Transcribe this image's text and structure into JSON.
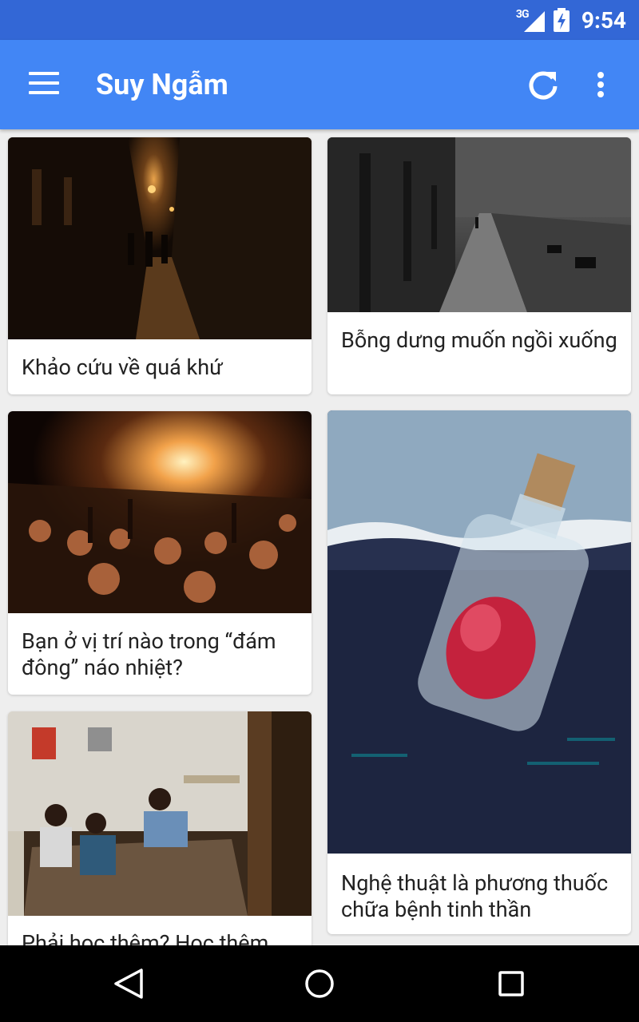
{
  "status_bar": {
    "network": "3G",
    "time": "9:54",
    "icons": [
      "signal-icon",
      "battery-charging-icon"
    ]
  },
  "app_bar": {
    "title": "Suy Ngẫm",
    "icons": [
      "menu-icon",
      "refresh-icon",
      "more-vert-icon"
    ]
  },
  "articles": [
    {
      "title": "Khảo cứu về quá khứ",
      "image": "night street photo"
    },
    {
      "title": "Bỗng dưng muốn ngồi xuống",
      "image": "rainy park path photo"
    },
    {
      "title": "Bạn ở vị trí nào trong “đám đông” náo nhiệt?",
      "image": "concert crowd photo"
    },
    {
      "title": "Nghệ thuật là phương thuốc chữa bệnh tinh thần",
      "image": "heart in bottle illustration"
    },
    {
      "title": "Phải học thêm? Học thêm",
      "image": "classroom photo"
    }
  ],
  "nav_bar": {
    "icons": [
      "back-icon",
      "home-icon",
      "recents-icon"
    ]
  },
  "colors": {
    "status_bar": "#3367d6",
    "app_bar": "#4286f5",
    "background": "#eeeeee",
    "nav_bar": "#000000"
  }
}
